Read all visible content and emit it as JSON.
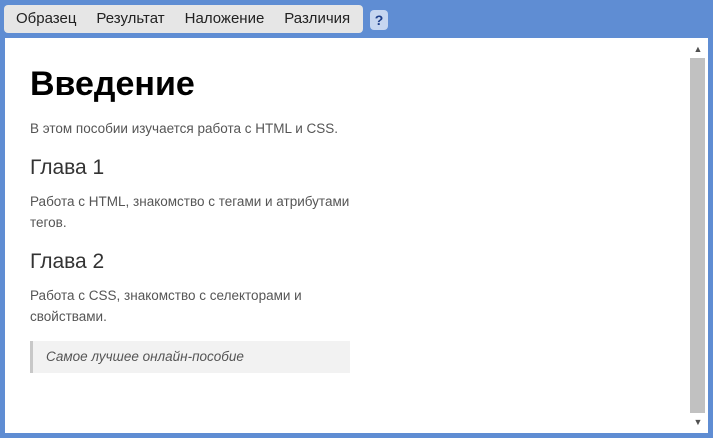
{
  "tabs": [
    "Образец",
    "Результат",
    "Наложение",
    "Различия"
  ],
  "help_label": "?",
  "doc": {
    "title": "Введение",
    "intro": "В этом пособии изучается работа с HTML и CSS.",
    "sections": [
      {
        "heading": "Глава 1",
        "text": "Работа с HTML, знакомство с тегами и атрибутами тегов."
      },
      {
        "heading": "Глава 2",
        "text": "Работа с CSS, знакомство с селекторами и свойствами."
      }
    ],
    "quote": "Самое лучшее онлайн-пособие"
  },
  "scrollbar": {
    "up_glyph": "▲",
    "down_glyph": "▼"
  },
  "colors": {
    "frame_border": "#5f8dd3",
    "tab_background": "#e6e6e6",
    "help_background": "#c6d6f0"
  }
}
